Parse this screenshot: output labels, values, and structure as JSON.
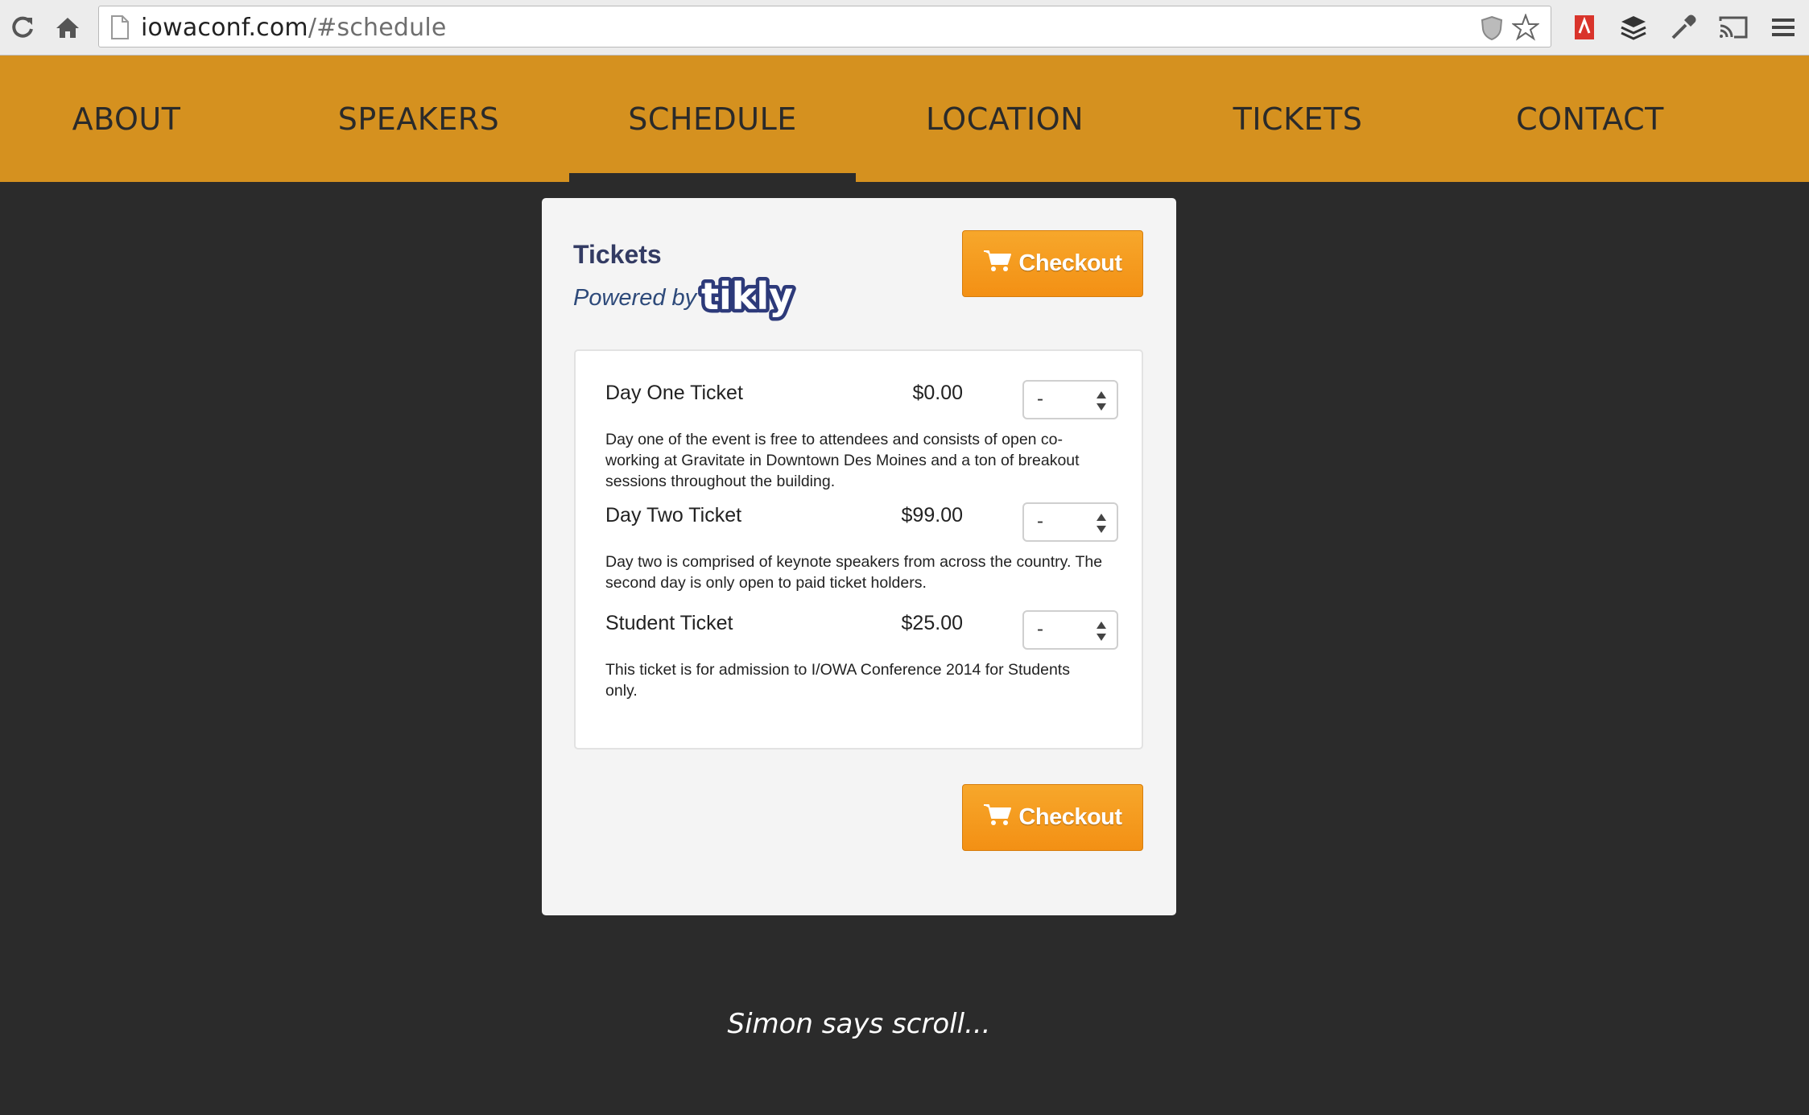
{
  "browser": {
    "url_host": "iowaconf.com",
    "url_path": "/#schedule"
  },
  "nav": {
    "items": [
      {
        "label": "ABOUT"
      },
      {
        "label": "SPEAKERS"
      },
      {
        "label": "SCHEDULE",
        "active": true
      },
      {
        "label": "LOCATION"
      },
      {
        "label": "TICKETS"
      },
      {
        "label": "CONTACT"
      }
    ]
  },
  "tickets_widget": {
    "title": "Tickets",
    "powered_by": "Powered by",
    "brand": "tikly",
    "checkout_label": "Checkout",
    "items": [
      {
        "name": "Day One Ticket",
        "price": "$0.00",
        "quantity": "-",
        "description": "Day one of the event is free to attendees and consists of open co-working at Gravitate in Downtown Des Moines and a ton of breakout sessions throughout the building."
      },
      {
        "name": "Day Two Ticket",
        "price": "$99.00",
        "quantity": "-",
        "description": "Day two is comprised of keynote speakers from across the country. The second day is only open to paid ticket holders."
      },
      {
        "name": "Student Ticket",
        "price": "$25.00",
        "quantity": "-",
        "description": "This ticket is for admission to I/OWA Conference 2014 for Students only."
      }
    ]
  },
  "footer": {
    "scroll_hint": "Simon says scroll..."
  },
  "colors": {
    "nav_bg": "#d5911f",
    "page_bg": "#2b2b2b",
    "checkout_orange": "#f39014",
    "title_navy": "#333b63"
  }
}
